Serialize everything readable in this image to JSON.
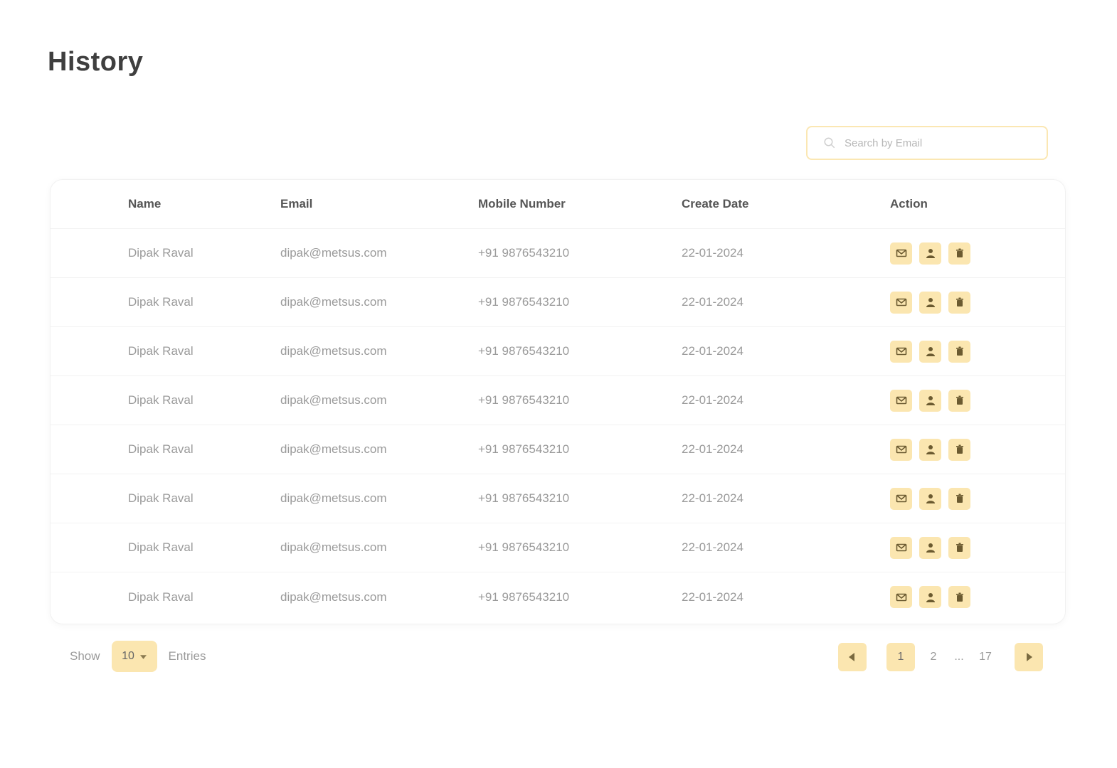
{
  "page": {
    "title": "History"
  },
  "search": {
    "placeholder": "Search by Email"
  },
  "table": {
    "headers": {
      "name": "Name",
      "email": "Email",
      "mobile": "Mobile Number",
      "date": "Create Date",
      "action": "Action"
    },
    "rows": [
      {
        "name": "Dipak Raval",
        "email": "dipak@metsus.com",
        "mobile": "+91 9876543210",
        "date": "22-01-2024"
      },
      {
        "name": "Dipak Raval",
        "email": "dipak@metsus.com",
        "mobile": "+91 9876543210",
        "date": "22-01-2024"
      },
      {
        "name": "Dipak Raval",
        "email": "dipak@metsus.com",
        "mobile": "+91 9876543210",
        "date": "22-01-2024"
      },
      {
        "name": "Dipak Raval",
        "email": "dipak@metsus.com",
        "mobile": "+91 9876543210",
        "date": "22-01-2024"
      },
      {
        "name": "Dipak Raval",
        "email": "dipak@metsus.com",
        "mobile": "+91 9876543210",
        "date": "22-01-2024"
      },
      {
        "name": "Dipak Raval",
        "email": "dipak@metsus.com",
        "mobile": "+91 9876543210",
        "date": "22-01-2024"
      },
      {
        "name": "Dipak Raval",
        "email": "dipak@metsus.com",
        "mobile": "+91 9876543210",
        "date": "22-01-2024"
      },
      {
        "name": "Dipak Raval",
        "email": "dipak@metsus.com",
        "mobile": "+91 9876543210",
        "date": "22-01-2024"
      }
    ],
    "action_icons": [
      "mail-icon",
      "user-icon",
      "delete-icon"
    ]
  },
  "footer": {
    "show_label": "Show",
    "entries_value": "10",
    "entries_label": "Entries"
  },
  "pagination": {
    "current": "1",
    "page_2": "2",
    "ellipsis": "...",
    "last": "17",
    "prev_icon": "chevron-left-icon",
    "next_icon": "chevron-right-icon"
  },
  "colors": {
    "accent": "#fbe6b0",
    "search_border": "#fbe7b3",
    "text_muted": "#9a9a9a",
    "text_header": "#555555"
  }
}
